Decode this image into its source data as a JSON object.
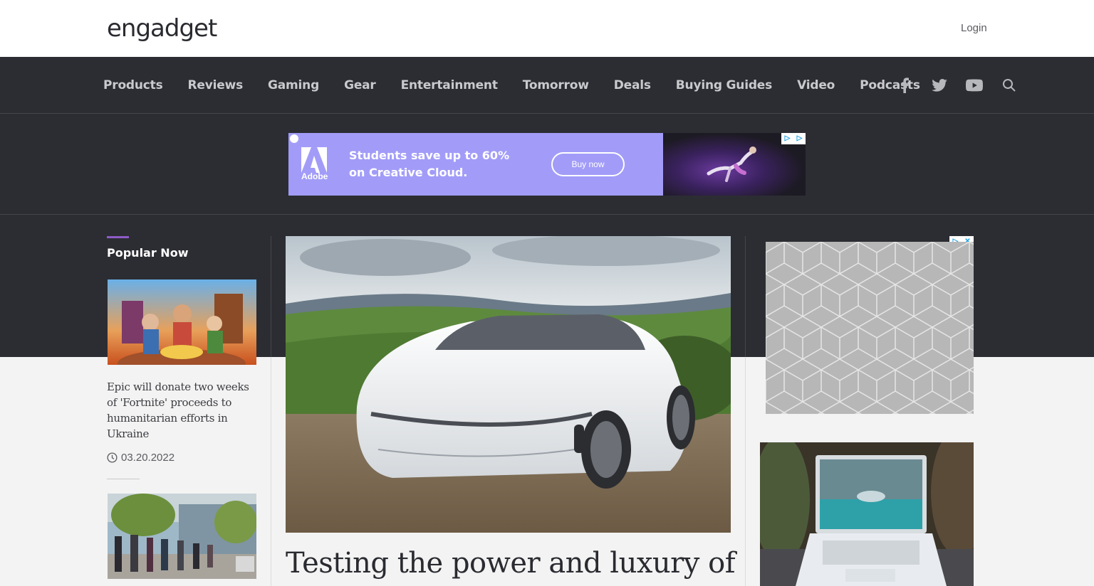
{
  "header": {
    "logo_text": "engadget",
    "login_label": "Login"
  },
  "nav": {
    "items": [
      {
        "label": "Products"
      },
      {
        "label": "Reviews"
      },
      {
        "label": "Gaming"
      },
      {
        "label": "Gear"
      },
      {
        "label": "Entertainment"
      },
      {
        "label": "Tomorrow"
      },
      {
        "label": "Deals"
      },
      {
        "label": "Buying Guides"
      },
      {
        "label": "Video"
      },
      {
        "label": "Podcasts"
      }
    ],
    "icons": [
      "facebook-icon",
      "twitter-icon",
      "youtube-icon",
      "search-icon"
    ]
  },
  "ad_banner": {
    "brand": "Adobe",
    "line1": "Students save up to 60%",
    "line2": "on Creative Cloud.",
    "button_label": "Buy now",
    "bg_color": "#a29cf8"
  },
  "popular": {
    "heading": "Popular Now",
    "items": [
      {
        "headline": "Epic will donate two weeks of 'Fortnite' proceeds to humanitarian efforts in Ukraine",
        "date": "03.20.2022"
      }
    ]
  },
  "main_article": {
    "title": "Testing the power and luxury of"
  },
  "colors": {
    "dark_band": "#2c2d33",
    "accent": "#8e5bc7",
    "nav_text": "#c9cacd"
  }
}
